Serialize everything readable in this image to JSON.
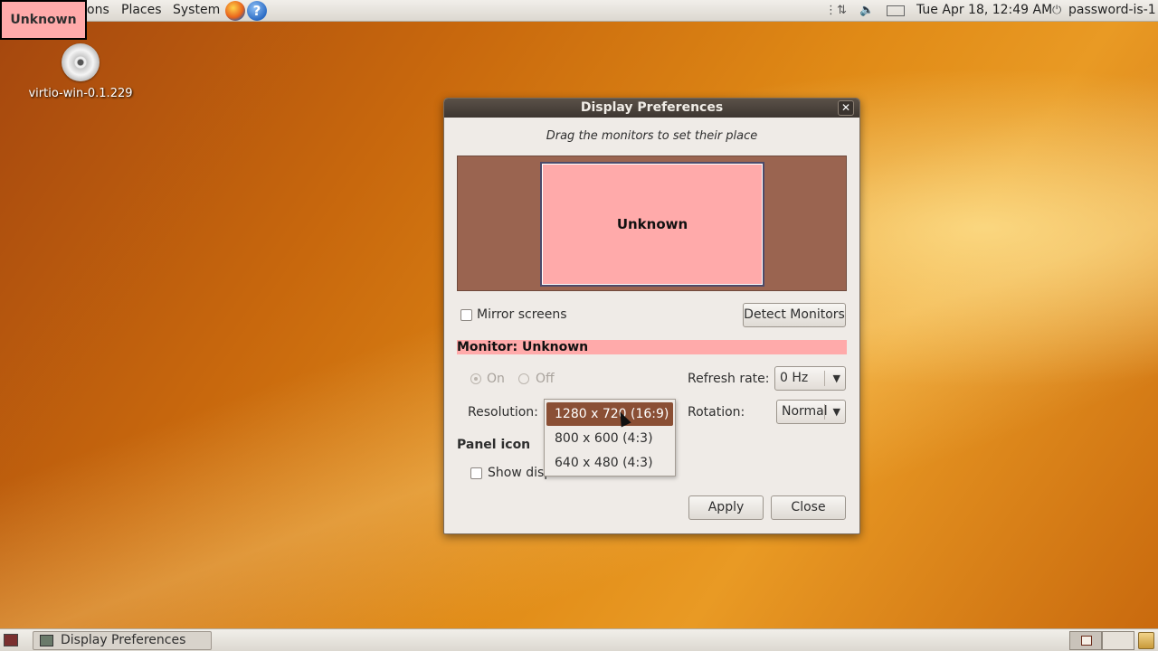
{
  "top_panel": {
    "applications_fragment": "ons",
    "places": "Places",
    "system": "System",
    "help_glyph": "?",
    "clock": "Tue Apr 18, 12:49 AM",
    "user": "password-is-1",
    "badge": "Unknown"
  },
  "desktop": {
    "icon_label": "virtio-win-0.1.229"
  },
  "dialog": {
    "title": "Display Preferences",
    "close_glyph": "✕",
    "hint": "Drag the monitors to set their place",
    "monitor_label": "Unknown",
    "mirror_screens": "Mirror screens",
    "detect_monitors": "Detect Monitors",
    "monitor_header": "Monitor: Unknown",
    "on_label": "On",
    "off_label": "Off",
    "refresh_rate_label": "Refresh rate:",
    "refresh_rate_value": "0 Hz",
    "resolution_label": "Resolution:",
    "rotation_label": "Rotation:",
    "rotation_value": "Normal",
    "panel_icon_heading": "Panel icon",
    "show_display_fragment": "Show disp",
    "apply": "Apply",
    "close": "Close"
  },
  "resolution_dropdown": {
    "options": [
      "1280 x 720 (16:9)",
      "800 x 600 (4:3)",
      "640 x 480 (4:3)"
    ],
    "selected_index": 0
  },
  "bottom_panel": {
    "task_label": "Display Preferences"
  },
  "colors": {
    "monitor_highlight": "#ffaaaa",
    "titlebar": "#3d3631",
    "dropdown_selected": "#8a4f35",
    "monitor_area": "#9a6450"
  }
}
